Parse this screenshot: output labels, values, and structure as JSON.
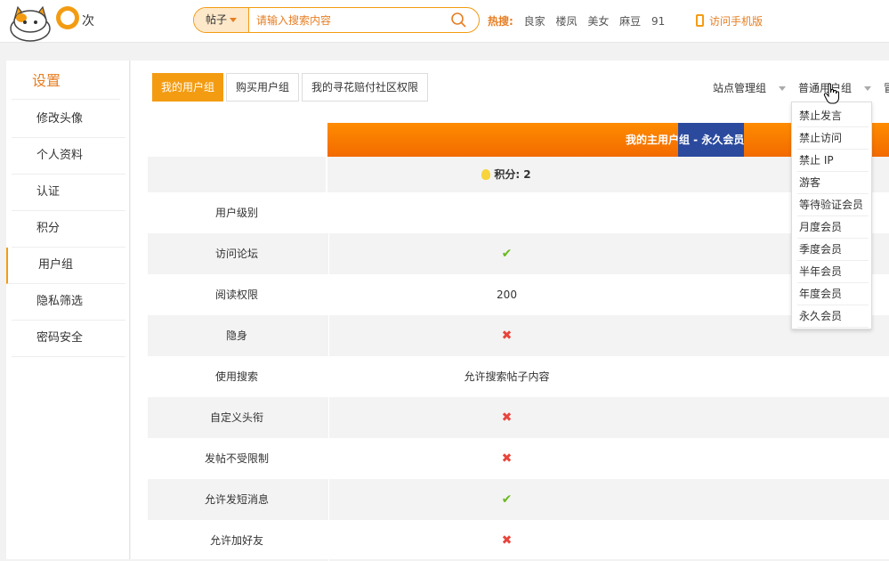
{
  "header": {
    "search_type": "帖子",
    "search_placeholder": "请输入搜索内容",
    "hot_label": "热搜:",
    "hot_keywords": [
      "良家",
      "楼凤",
      "美女",
      "麻豆",
      "91"
    ],
    "mobile_link": "访问手机版"
  },
  "sidebar": {
    "title": "设置",
    "items": [
      {
        "label": "修改头像"
      },
      {
        "label": "个人资料"
      },
      {
        "label": "认证"
      },
      {
        "label": "积分"
      },
      {
        "label": "用户组"
      },
      {
        "label": "隐私筛选"
      },
      {
        "label": "密码安全"
      }
    ]
  },
  "tabs": [
    {
      "label": "我的用户组"
    },
    {
      "label": "购买用户组"
    },
    {
      "label": "我的寻花赔付社区权限"
    }
  ],
  "right_nav": {
    "site_admin": "站点管理组",
    "normal_group": "普通用户组",
    "extra": "冒"
  },
  "table": {
    "header": "我的主用户组 - 永久会员",
    "points": "积分: 2",
    "rows": [
      {
        "label": "用户级别",
        "value": "",
        "type": "text"
      },
      {
        "label": "访问论坛",
        "value": "✔",
        "type": "check"
      },
      {
        "label": "阅读权限",
        "value": "200",
        "type": "text"
      },
      {
        "label": "隐身",
        "value": "✖",
        "type": "cross"
      },
      {
        "label": "使用搜索",
        "value": "允许搜索帖子内容",
        "type": "text"
      },
      {
        "label": "自定义头衔",
        "value": "✖",
        "type": "cross"
      },
      {
        "label": "发帖不受限制",
        "value": "✖",
        "type": "cross"
      },
      {
        "label": "允许发短消息",
        "value": "✔",
        "type": "check"
      },
      {
        "label": "允许加好友",
        "value": "✖",
        "type": "cross"
      }
    ]
  },
  "dropdown": {
    "items": [
      "禁止发言",
      "禁止访问",
      "禁止 IP",
      "游客",
      "等待验证会员",
      "月度会员",
      "季度会员",
      "半年会员",
      "年度会员",
      "永久会员"
    ]
  },
  "colors": {
    "accent": "#f39c12",
    "header_gradient_top": "#ff8c00",
    "header_highlight": "#2b4a9e",
    "check": "#6ab820",
    "cross": "#e8453c"
  }
}
